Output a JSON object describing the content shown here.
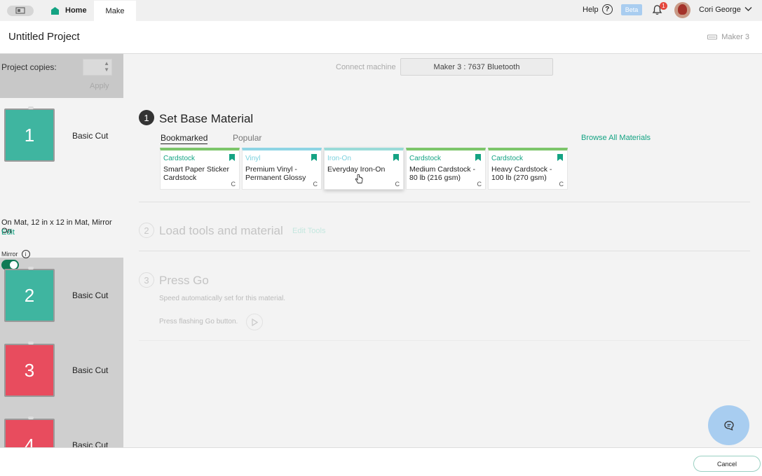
{
  "topbar": {
    "home_label": "Home",
    "make_label": "Make",
    "help_label": "Help",
    "help_glyph": "?",
    "beta_label": "Beta",
    "notification_count": "1",
    "user_name": "Cori George"
  },
  "header": {
    "project_title": "Untitled Project",
    "machine_name": "Maker 3"
  },
  "sidebar": {
    "copies_label": "Project copies:",
    "apply_label": "Apply",
    "mat_info": "On Mat, 12 in x 12 in Mat, Mirror On",
    "edit_label": "Edit",
    "mirror_label": "Mirror",
    "mirror_on": true,
    "mats": [
      {
        "number": "1",
        "label": "Basic Cut",
        "color": "#3fb5a0"
      },
      {
        "number": "2",
        "label": "Basic Cut",
        "color": "#3fb5a0"
      },
      {
        "number": "3",
        "label": "Basic Cut",
        "color": "#e84c5e"
      },
      {
        "number": "4",
        "label": "Basic Cut",
        "color": "#e84c5e"
      }
    ]
  },
  "connect": {
    "label": "Connect machine",
    "value": "Maker 3 : 7637 Bluetooth"
  },
  "steps": [
    {
      "number": "1",
      "title": "Set Base Material"
    },
    {
      "number": "2",
      "title": "Load tools and material",
      "link": "Edit Tools"
    },
    {
      "number": "3",
      "title": "Press Go",
      "speed_text": "Speed automatically set for this material.",
      "go_text": "Press flashing Go button."
    }
  ],
  "materials": {
    "tabs": [
      "Bookmarked",
      "Popular"
    ],
    "browse_label": "Browse All Materials",
    "cards": [
      {
        "category": "Cardstock",
        "name": "Smart Paper Sticker Cardstock",
        "badge": "C"
      },
      {
        "category": "Vinyl",
        "name": "Premium Vinyl - Permanent Glossy",
        "badge": "C"
      },
      {
        "category": "Iron-On",
        "name": "Everyday Iron-On",
        "badge": "C"
      },
      {
        "category": "Cardstock",
        "name": "Medium Cardstock - 80 lb (216 gsm)",
        "badge": "C"
      },
      {
        "category": "Cardstock",
        "name": "Heavy Cardstock - 100 lb (270 gsm)",
        "badge": "C"
      }
    ]
  },
  "footer": {
    "cancel_label": "Cancel"
  },
  "colors": {
    "accent": "#14a383",
    "toggle_on": "#0f7a55",
    "chat_button": "#a8cdf0"
  }
}
